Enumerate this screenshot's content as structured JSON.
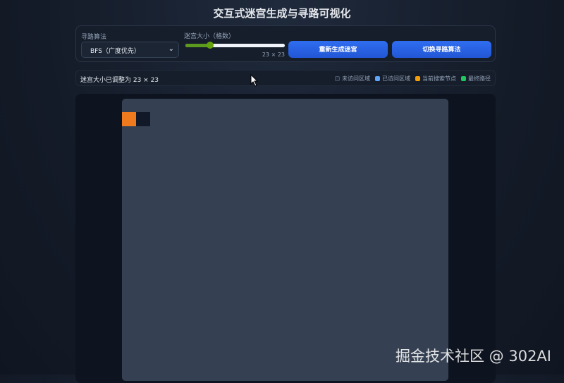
{
  "title": "交互式迷宫生成与寻路可视化",
  "controls": {
    "algo_label": "寻路算法",
    "algo_value": "BFS（广度优先）",
    "size_label": "迷宫大小（格数）",
    "size_value": "23 × 23",
    "size_fraction": 0.25,
    "regen_button": "重新生成迷宫",
    "switch_button": "切换寻路算法"
  },
  "status": {
    "message": "迷宫大小已调整为 23 × 23"
  },
  "legend": [
    {
      "label": "未访问区域",
      "color": "#1e293b"
    },
    {
      "label": "已访问区域",
      "color": "#60a5fa"
    },
    {
      "label": "当前搜索节点",
      "color": "#f59e0b"
    },
    {
      "label": "最终路径",
      "color": "#22c55e"
    }
  ],
  "colors": {
    "start": "#f07a1e",
    "wall": "#111827",
    "board": "#354152"
  },
  "watermark": "掘金技术社区 @ 302AI"
}
